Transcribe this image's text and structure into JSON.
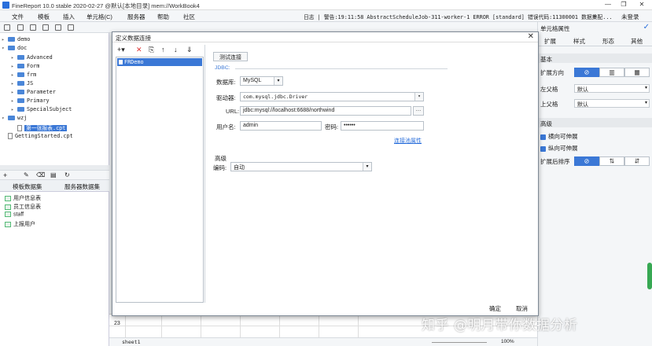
{
  "window": {
    "title": "FineReport 10.0 stable 2020-02-27 @默认[本地目录]   mem://WorkBook4",
    "controls": [
      "—",
      "❐",
      "✕"
    ]
  },
  "menu": {
    "items": [
      "文件",
      "模板",
      "插入",
      "单元格(C)",
      "服务器",
      "帮助",
      "社区"
    ],
    "log": "日志 | 警告:19:11:58 AbstractScheduleJob-311-worker-1 ERROR [standard] 错误代码:11300001 数据集配...",
    "login": "未登录"
  },
  "tree": {
    "nodes": [
      {
        "label": "demo",
        "kind": "folder"
      },
      {
        "label": "doc",
        "kind": "folder"
      },
      {
        "label": "Advanced",
        "kind": "folder"
      },
      {
        "label": "Form",
        "kind": "folder"
      },
      {
        "label": "frm",
        "kind": "folder"
      },
      {
        "label": "JS",
        "kind": "folder"
      },
      {
        "label": "Parameter",
        "kind": "folder"
      },
      {
        "label": "Primary",
        "kind": "folder"
      },
      {
        "label": "SpecialSubject",
        "kind": "folder"
      },
      {
        "label": "wzj",
        "kind": "folder"
      },
      {
        "label": "第一张报表.cpt",
        "kind": "file"
      },
      {
        "label": "GettingStarted.cpt",
        "kind": "file"
      }
    ]
  },
  "datasets": {
    "tabs": [
      "模板数据集",
      "服务器数据集"
    ],
    "items": [
      "用户信息表",
      "员工信息表",
      "staff",
      "上报用户"
    ]
  },
  "props": {
    "header": "单元格属性",
    "tabs": [
      "扩展",
      "样式",
      "形态",
      "其他"
    ],
    "sec_basic": "基本",
    "expand_dir": "扩展方向",
    "left_parent": "左父格",
    "left_parent_val": "默认",
    "up_parent": "上父格",
    "up_parent_val": "默认",
    "sec_adv": "高级",
    "h_expand": "横向可伸展",
    "v_expand": "纵向可伸展",
    "sort_after": "扩展后排序"
  },
  "dialog": {
    "title": "定义数据连接",
    "connection": "FRDemo",
    "test_btn": "测试连接",
    "section_jdbc": "JDBC:",
    "db_label": "数据库:",
    "db_value": "MySQL",
    "driver_label": "驱动器:",
    "driver_value": "com.mysql.jdbc.Driver",
    "url_label": "URL:",
    "url_value": "jdbc:mysql://localhost:6688/northwind",
    "user_label": "用户名:",
    "user_value": "admin",
    "pwd_label": "密码:",
    "pwd_value": "••••••",
    "adv_link": "连接池属性",
    "adv_section": "高级",
    "enc_label": "编码:",
    "enc_value": "自动",
    "ok": "确定",
    "cancel": "取消"
  },
  "sheet": {
    "row": "23",
    "name": "sheet1",
    "zoom": "100%"
  },
  "watermark": "知乎 @明月带你数据分析"
}
